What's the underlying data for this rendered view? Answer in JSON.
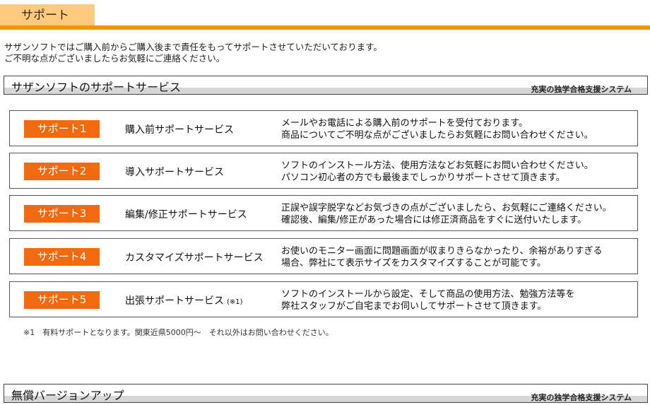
{
  "header": {
    "tab_label": "サポート"
  },
  "intro": {
    "line1": "サザンソフトではご購入前からご購入後まで責任をもってサポートさせていただいております。",
    "line2": "ご不明な点がございましたらお気軽にご連絡ください。"
  },
  "section_support": {
    "title": "サザンソフトのサポートサービス",
    "subtitle": "充実の独学合格支援システム"
  },
  "cards": [
    {
      "badge": "サポート1",
      "name": "購入前サポートサービス",
      "note": "",
      "desc1": "メールやお電話による購入前のサポートを受付ております。",
      "desc2": "商品についてご不明な点がございましたらお気軽にお問い合わせください。"
    },
    {
      "badge": "サポート2",
      "name": "導入サポートサービス",
      "note": "",
      "desc1": "ソフトのインストール方法、使用方法などお気軽にお問い合わせください。",
      "desc2": "パソコン初心者の方でも最後までしっかりサポートさせて頂きます。"
    },
    {
      "badge": "サポート3",
      "name": "編集/修正サポートサービス",
      "note": "",
      "desc1": "正誤や誤字脱字などお気づきの点がございましたら、お気軽にご連絡ください。",
      "desc2": "確認後、編集/修正があった場合には修正済商品をすぐに送付いたします。"
    },
    {
      "badge": "サポート4",
      "name": "カスタマイズサポートサービス",
      "note": "",
      "desc1": "お使いのモニター画面に問題画面が収まりきらなかったり、余裕がありすぎる",
      "desc2": "場合、弊社にて表示サイズをカスタマイズすることが可能です。"
    },
    {
      "badge": "サポート5",
      "name": "出張サポートサービス",
      "note": "(※1)",
      "desc1": "ソフトのインストールから設定、そして商品の使用方法、勉強方法等を",
      "desc2": "弊社スタッフがご自宅までお伺いしてサポートさせて頂きます。"
    }
  ],
  "footnote": "※1　有料サポートとなります。関東近県5000円～　それ以外はお問い合わせください。",
  "section_upgrade": {
    "title": "無償バージョンアップ",
    "subtitle": "充実の独学合格支援システム"
  }
}
